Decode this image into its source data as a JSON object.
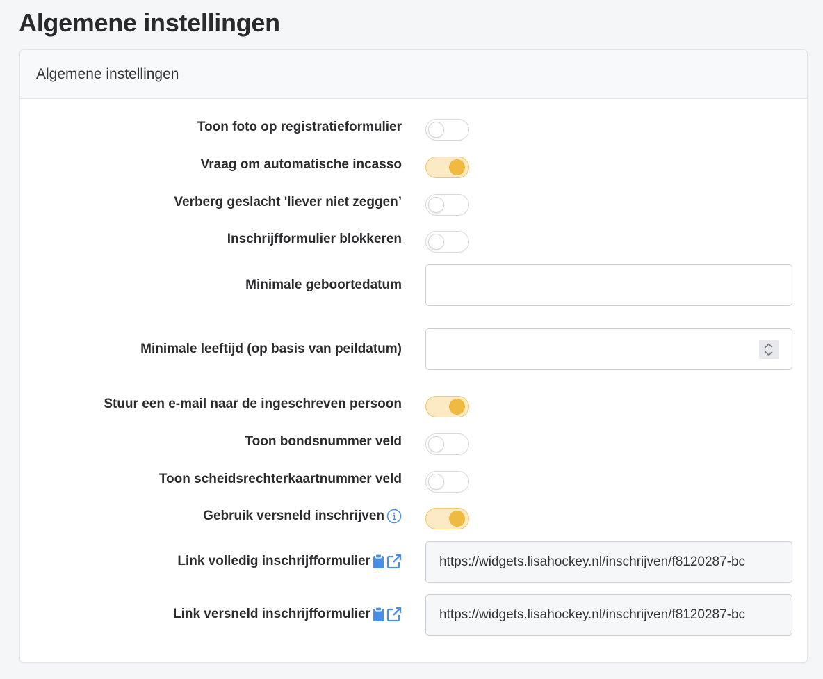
{
  "page": {
    "title": "Algemene instellingen"
  },
  "card": {
    "header": "Algemene instellingen",
    "settings": {
      "show_photo": {
        "label": "Toon foto op registratieformulier",
        "enabled": false
      },
      "ask_direct_debit": {
        "label": "Vraag om automatische incasso",
        "enabled": true
      },
      "hide_gender_option": {
        "label": "Verberg geslacht 'liever niet zeggen’",
        "enabled": false
      },
      "block_form": {
        "label": "Inschrijfformulier blokkeren",
        "enabled": false
      },
      "min_birthdate": {
        "label": "Minimale geboortedatum",
        "value": ""
      },
      "min_age": {
        "label": "Minimale leeftijd (op basis van peildatum)",
        "value": ""
      },
      "send_email": {
        "label": "Stuur een e-mail naar de ingeschreven persoon",
        "enabled": true
      },
      "show_union_number": {
        "label": "Toon bondsnummer veld",
        "enabled": false
      },
      "show_referee_card": {
        "label": "Toon scheidsrechterkaartnummer veld",
        "enabled": false
      },
      "fast_signup": {
        "label": "Gebruik versneld inschrijven",
        "enabled": true
      },
      "link_full": {
        "label": "Link volledig inschrijfformulier",
        "value": "https://widgets.lisahockey.nl/inschrijven/f8120287-bc"
      },
      "link_fast": {
        "label": "Link versneld inschrijfformulier",
        "value": "https://widgets.lisahockey.nl/inschrijven/f8120287-bc"
      }
    }
  },
  "icons": {
    "info": "info-circle-icon",
    "clipboard": "clipboard-icon",
    "external": "external-link-icon",
    "accent": "#4a8fe7",
    "toggle_on": "#f0b93f"
  }
}
